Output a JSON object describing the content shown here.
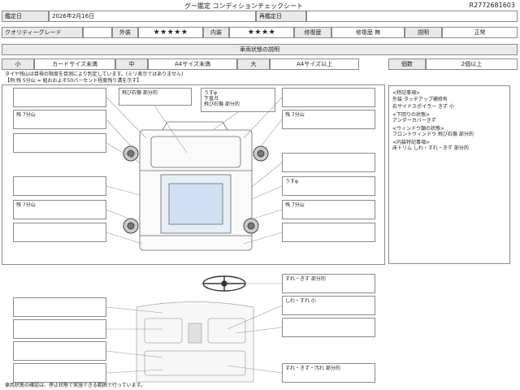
{
  "header": {
    "title": "グー鑑定  コンディションチェックシート",
    "doc_number": "R2772681603"
  },
  "row1": {
    "date_label": "鑑定日",
    "date_value": "2026年2月16日",
    "reappraisal_label": "再鑑定日",
    "reappraisal_value": ""
  },
  "row2": {
    "quality_label": "クオリティーグレード",
    "quality_value": "",
    "exterior_label": "外装",
    "exterior_stars": "★★★★★",
    "interior_label": "内装",
    "interior_stars": "★★★★",
    "repair_label": "修復歴",
    "repair_value": "修復歴 無",
    "manual_label": "説明",
    "manual_value": "正常"
  },
  "section_title": "車両状態の説明",
  "legend": {
    "small": "小",
    "small_desc": "カードサイズ未満",
    "medium": "中",
    "medium_desc": "A4サイズ未満",
    "large": "大",
    "large_desc": "A4サイズ以上",
    "count_label": "個数",
    "count_desc": "2個以上"
  },
  "tire_note": {
    "line1": "タイヤ残山は目視の限度を目測により判定しています。(ミリ表示ではありません)",
    "line2": "【例:残 5分山 = 組おおよそ50パーセント程度残り溝を示す】"
  },
  "damage_left": [
    {
      "text": ""
    },
    {
      "text": "残 7分山"
    },
    {
      "text": ""
    },
    {
      "text": ""
    },
    {
      "text": "残 7分山"
    },
    {
      "text": ""
    }
  ],
  "damage_top": [
    {
      "text": "飛び石傷 部分的"
    },
    {
      "text": "うすφ\n下直ガ\n飛び石傷 部分的"
    }
  ],
  "damage_right": [
    {
      "text": ""
    },
    {
      "text": "残 7分山"
    },
    {
      "text": ""
    },
    {
      "text": "うすφ"
    },
    {
      "text": "残 7分山"
    },
    {
      "text": ""
    }
  ],
  "damage_interior_right": [
    {
      "text": "すれ・きず 部分的"
    },
    {
      "text": "しわ・すれ 小"
    },
    {
      "text": ""
    },
    {
      "text": "すれ・きず・汚れ 部分的"
    }
  ],
  "notes": {
    "special_label": "<特記事項>",
    "special_lines": [
      "外装 タッチアップ補修有",
      "右サイドスポイラー きず 小"
    ],
    "under_label": "<下回りの状態>",
    "under_lines": [
      "アンダーカバーきず"
    ],
    "glass_label": "<ウィンドウ類の状態>",
    "glass_lines": [
      "フロントウィンドウ 飛び石傷 部分的"
    ],
    "interior_label": "<内装特記事項>",
    "interior_lines": [
      "床トリム しわ・すれ・きず 部分的"
    ]
  },
  "footer": "車両状態の確認は、停止状態で実施できる範囲で行っています。"
}
